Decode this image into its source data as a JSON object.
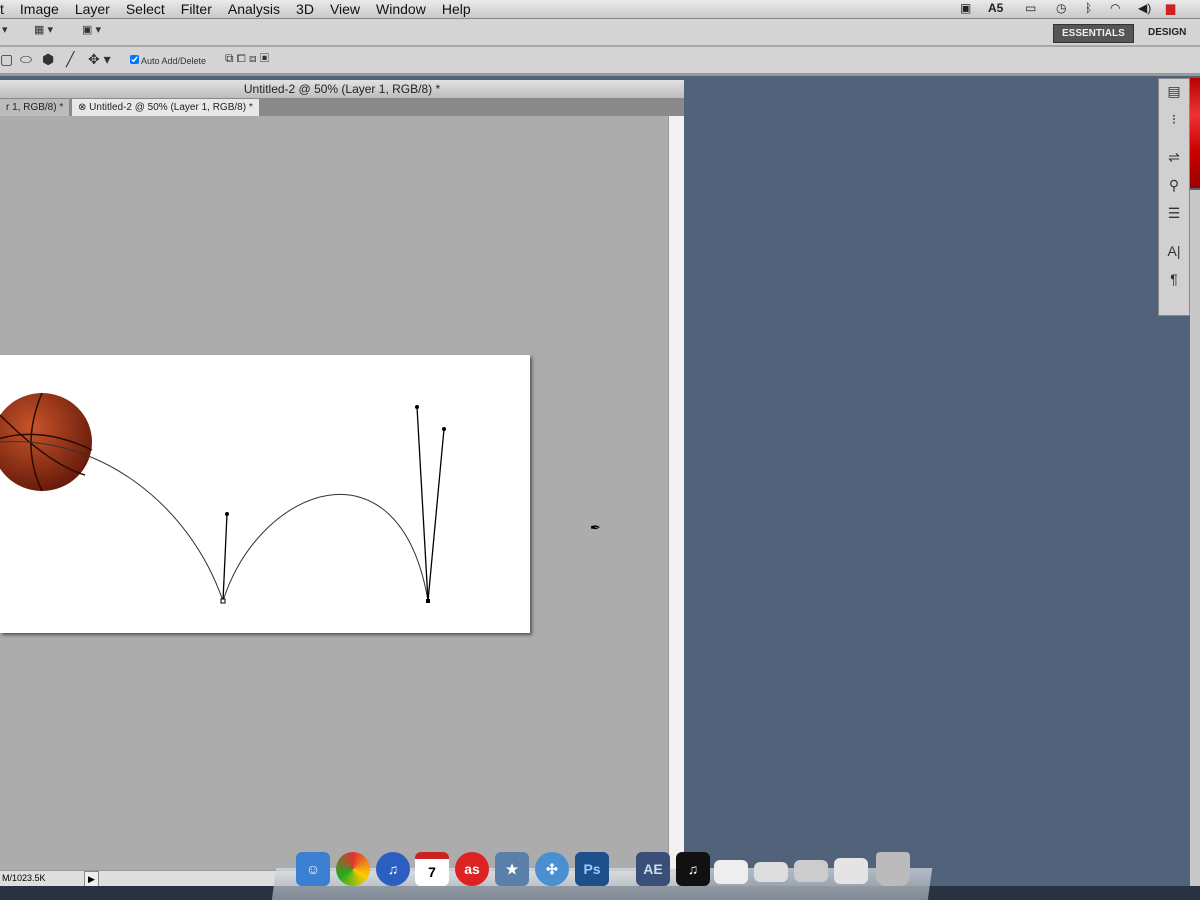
{
  "menubar": {
    "items": [
      "t",
      "Image",
      "Layer",
      "Select",
      "Filter",
      "Analysis",
      "3D",
      "View",
      "Window",
      "Help"
    ],
    "status": {
      "adobe": "5"
    }
  },
  "workspace": {
    "essentials": "ESSENTIALS",
    "design": "DESIGN"
  },
  "options": {
    "auto_add_delete": "Auto Add/Delete",
    "auto_add_delete_checked": true
  },
  "document": {
    "title": "Untitled-2 @ 50% (Layer 1, RGB/8) *",
    "tabs": [
      {
        "label": "r 1, RGB/8) *"
      },
      {
        "label": "Untitled-2 @ 50% (Layer 1, RGB/8) *",
        "active": true
      }
    ],
    "status": "M/1023.5K"
  },
  "dock": {
    "items": [
      "Finder",
      "Chrome",
      "iTunes",
      "iCal",
      "Last.fm",
      "iMovie",
      "Safari",
      "Ps",
      "AE",
      "Music",
      "Window 1",
      "Window 2",
      "Window 3",
      "Window 4",
      "Trash"
    ],
    "ps_label": "Ps",
    "ae_label": "AE",
    "ical_day": "7",
    "lastfm_label": "as"
  },
  "colors": {
    "desktop": "#52627a",
    "canvas_bg": "#acacac"
  }
}
